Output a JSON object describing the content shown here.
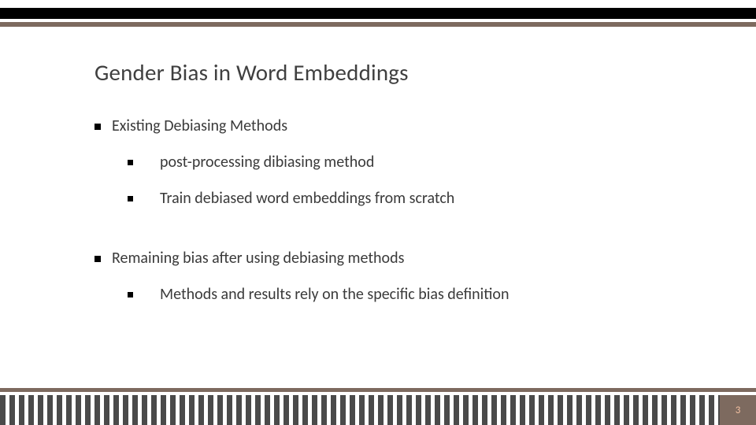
{
  "title": "Gender Bias in Word Embeddings",
  "sections": [
    {
      "heading": "Existing Debiasing Methods",
      "items": [
        "post-processing dibiasing method",
        "Train debiased word embeddings from scratch"
      ]
    },
    {
      "heading": "Remaining bias after using debiasing methods",
      "items": [
        "Methods and results rely on the specific bias definition"
      ]
    }
  ],
  "page_number": "3"
}
